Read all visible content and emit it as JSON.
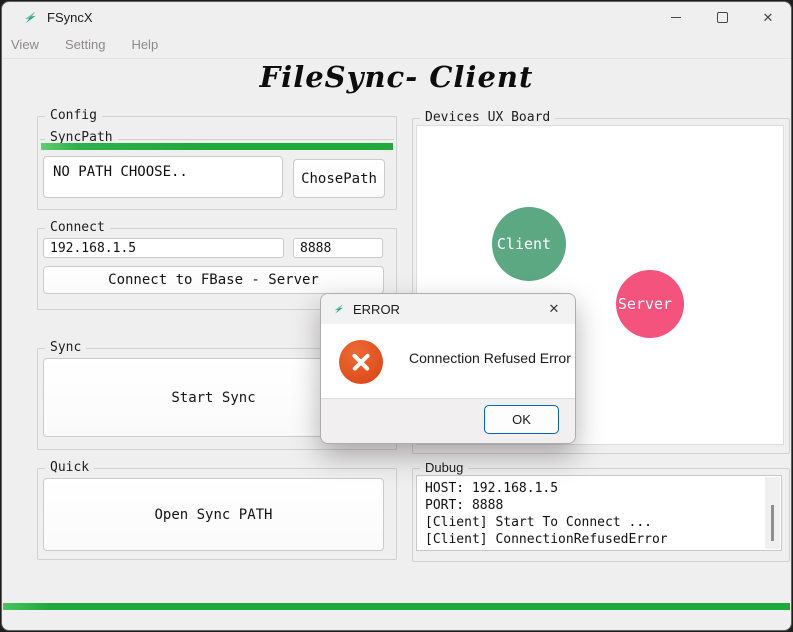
{
  "window": {
    "title": "FSyncX",
    "close_glyph": "✕"
  },
  "menu": {
    "items": [
      "View",
      "Setting",
      "Help"
    ]
  },
  "app_title": "FileSync- Client",
  "config": {
    "group_label": "Config",
    "syncpath_label": "SyncPath",
    "progress_percent": 100,
    "path_value": "NO PATH CHOOSE..",
    "chose_path_button": "ChosePath"
  },
  "connect": {
    "group_label": "Connect",
    "host_value": "192.168.1.5",
    "port_value": "8888",
    "connect_button": "Connect to FBase - Server"
  },
  "sync": {
    "group_label": "Sync",
    "start_button": "Start Sync"
  },
  "quick": {
    "group_label": "Quick",
    "open_button": "Open Sync PATH"
  },
  "devices": {
    "group_label": "Devices UX Board",
    "nodes": [
      {
        "label": "Client",
        "color": "#5ba882"
      },
      {
        "label": "Server",
        "color": "#f4537e"
      }
    ]
  },
  "debug": {
    "group_label": "Dubug",
    "lines": [
      "HOST: 192.168.1.5",
      "PORT: 8888",
      "[Client] Start To Connect ...",
      "[Client] ConnectionRefusedError"
    ]
  },
  "bottom_progress_percent": 100,
  "dialog": {
    "title": "ERROR",
    "message": "Connection Refused Error",
    "ok_button": "OK",
    "close_glyph": "✕"
  },
  "colors": {
    "accent_green": "#1fa83c",
    "client_green": "#5ba882",
    "server_pink": "#f4537e",
    "error_orange": "#dd4c1e",
    "ok_border_blue": "#0067c0",
    "brand_teal": "#2fa286"
  }
}
